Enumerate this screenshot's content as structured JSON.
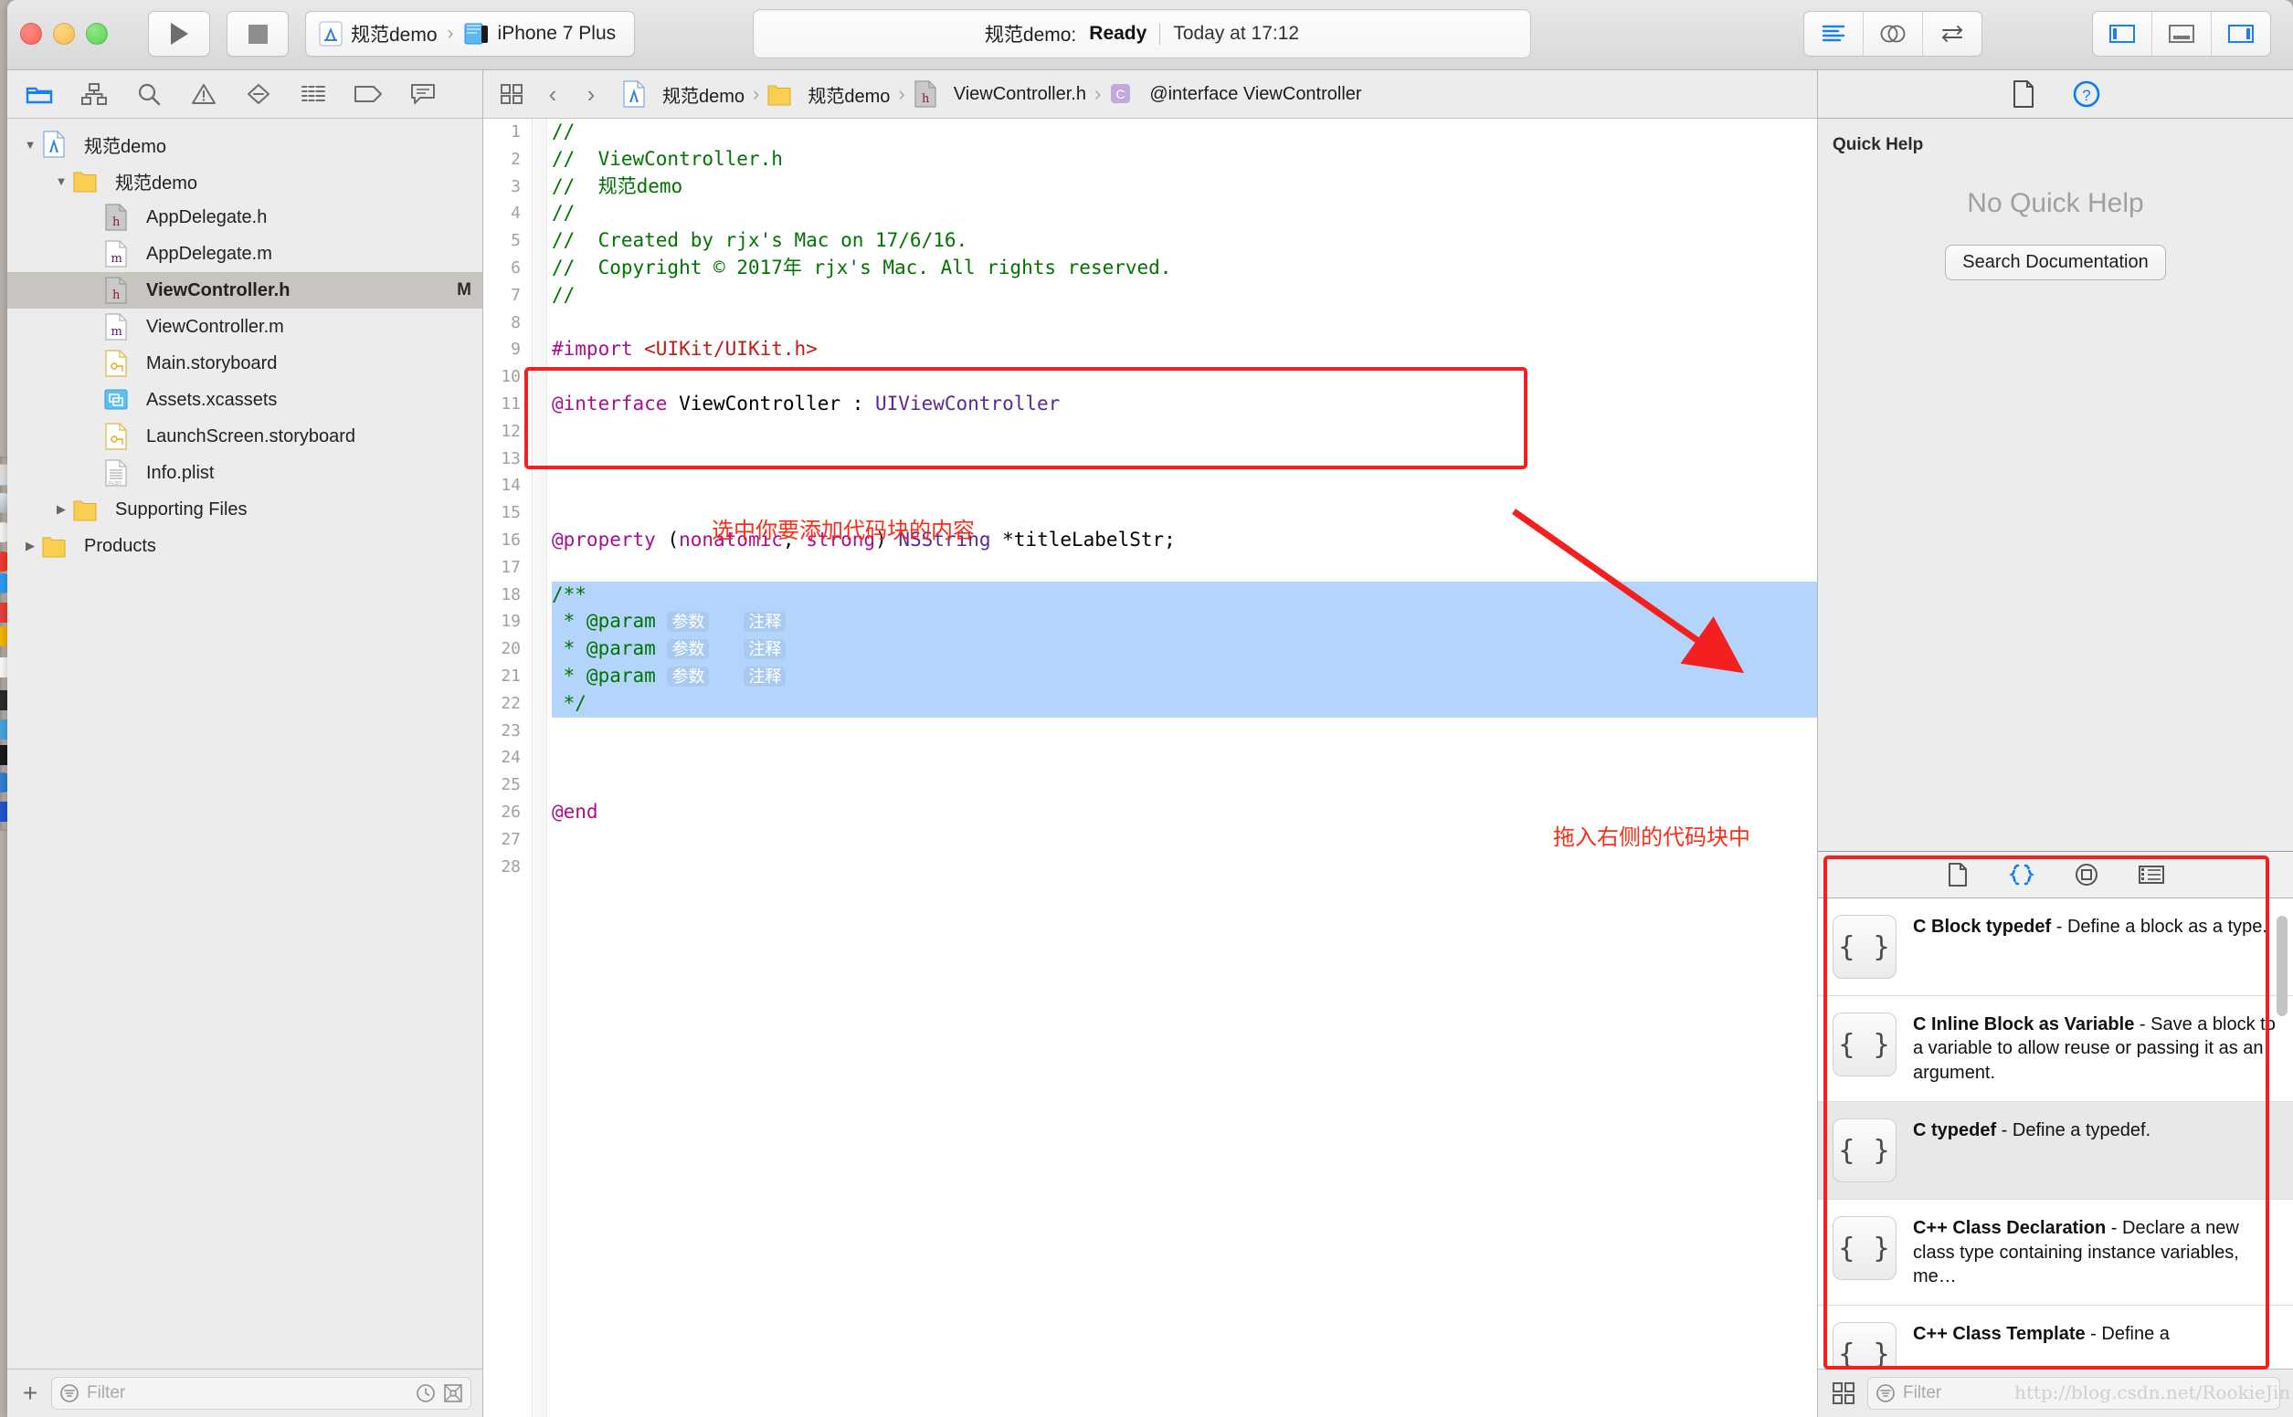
{
  "window": {
    "traffic_lights": [
      "close",
      "minimize",
      "zoom"
    ]
  },
  "toolbar": {
    "run_label": "Run",
    "stop_label": "Stop",
    "scheme_project": "规范demo",
    "scheme_separator": "›",
    "scheme_device": "iPhone 7 Plus",
    "status_project": "规范demo:",
    "status_state": "Ready",
    "status_time": "Today at 17:12",
    "editor_modes": [
      "standard-editor",
      "assistant-editor",
      "version-editor"
    ],
    "panel_toggles": [
      "navigator-toggle",
      "debug-area-toggle",
      "utilities-toggle"
    ]
  },
  "navigator": {
    "tabs": [
      "project-navigator",
      "source-control-navigator",
      "symbol-navigator",
      "find-navigator",
      "issue-navigator",
      "test-navigator",
      "debug-navigator",
      "breakpoint-navigator",
      "report-navigator"
    ],
    "active_tab": "project-navigator",
    "tree": [
      {
        "label": "规范demo",
        "icon": "xcode-project-icon",
        "indent": 0,
        "disclosure": "open",
        "selected": false,
        "flag": ""
      },
      {
        "label": "规范demo",
        "icon": "folder-icon",
        "indent": 1,
        "disclosure": "open",
        "selected": false,
        "flag": ""
      },
      {
        "label": "AppDelegate.h",
        "icon": "h-file-icon",
        "indent": 2,
        "disclosure": "none",
        "selected": false,
        "flag": ""
      },
      {
        "label": "AppDelegate.m",
        "icon": "m-file-icon",
        "indent": 2,
        "disclosure": "none",
        "selected": false,
        "flag": ""
      },
      {
        "label": "ViewController.h",
        "icon": "h-file-icon",
        "indent": 2,
        "disclosure": "none",
        "selected": true,
        "flag": "M"
      },
      {
        "label": "ViewController.m",
        "icon": "m-file-icon",
        "indent": 2,
        "disclosure": "none",
        "selected": false,
        "flag": ""
      },
      {
        "label": "Main.storyboard",
        "icon": "storyboard-icon",
        "indent": 2,
        "disclosure": "none",
        "selected": false,
        "flag": ""
      },
      {
        "label": "Assets.xcassets",
        "icon": "assets-icon",
        "indent": 2,
        "disclosure": "none",
        "selected": false,
        "flag": ""
      },
      {
        "label": "LaunchScreen.storyboard",
        "icon": "storyboard-icon",
        "indent": 2,
        "disclosure": "none",
        "selected": false,
        "flag": ""
      },
      {
        "label": "Info.plist",
        "icon": "plist-icon",
        "indent": 2,
        "disclosure": "none",
        "selected": false,
        "flag": ""
      },
      {
        "label": "Supporting Files",
        "icon": "folder-icon",
        "indent": 1,
        "disclosure": "closed",
        "selected": false,
        "flag": ""
      },
      {
        "label": "Products",
        "icon": "folder-icon",
        "indent": 0,
        "disclosure": "closed",
        "selected": false,
        "flag": ""
      }
    ],
    "add_label": "+",
    "filter_placeholder": "Filter"
  },
  "editor": {
    "breadcrumbs": [
      {
        "label": "规范demo",
        "icon": "xcode-project-icon"
      },
      {
        "label": "规范demo",
        "icon": "folder-icon"
      },
      {
        "label": "ViewController.h",
        "icon": "h-file-icon"
      },
      {
        "label": "@interface ViewController",
        "icon": "class-icon"
      }
    ],
    "back_arrow": "‹",
    "forward_arrow": "›",
    "lines": [
      {
        "n": 1,
        "segments": [
          {
            "t": "//",
            "c": "cmt"
          }
        ]
      },
      {
        "n": 2,
        "segments": [
          {
            "t": "//  ViewController.h",
            "c": "cmt"
          }
        ]
      },
      {
        "n": 3,
        "segments": [
          {
            "t": "//  规范demo",
            "c": "cmt"
          }
        ]
      },
      {
        "n": 4,
        "segments": [
          {
            "t": "//",
            "c": "cmt"
          }
        ]
      },
      {
        "n": 5,
        "segments": [
          {
            "t": "//  Created by rjx's Mac on 17/6/16.",
            "c": "cmt"
          }
        ]
      },
      {
        "n": 6,
        "segments": [
          {
            "t": "//  Copyright © 2017年 rjx's Mac. All rights reserved.",
            "c": "cmt"
          }
        ]
      },
      {
        "n": 7,
        "segments": [
          {
            "t": "//",
            "c": "cmt"
          }
        ]
      },
      {
        "n": 8,
        "segments": []
      },
      {
        "n": 9,
        "segments": [
          {
            "t": "#import ",
            "c": "kw"
          },
          {
            "t": "<UIKit/UIKit.h>",
            "c": "str"
          }
        ]
      },
      {
        "n": 10,
        "segments": []
      },
      {
        "n": 11,
        "segments": [
          {
            "t": "@interface",
            "c": "kw"
          },
          {
            "t": " ViewController : ",
            "c": ""
          },
          {
            "t": "UIViewController",
            "c": "typ"
          }
        ]
      },
      {
        "n": 12,
        "segments": []
      },
      {
        "n": 13,
        "segments": []
      },
      {
        "n": 14,
        "segments": []
      },
      {
        "n": 15,
        "segments": []
      },
      {
        "n": 16,
        "segments": [
          {
            "t": "@property",
            "c": "kw"
          },
          {
            "t": " (",
            "c": ""
          },
          {
            "t": "nonatomic",
            "c": "kw"
          },
          {
            "t": ", ",
            "c": ""
          },
          {
            "t": "strong",
            "c": "kw"
          },
          {
            "t": ") ",
            "c": ""
          },
          {
            "t": "NSString",
            "c": "typ"
          },
          {
            "t": " *titleLabelStr;",
            "c": ""
          }
        ]
      },
      {
        "n": 17,
        "segments": []
      },
      {
        "n": 18,
        "segments": [
          {
            "t": "/**",
            "c": "cmt"
          }
        ],
        "selected": true
      },
      {
        "n": 19,
        "segments": [
          {
            "t": " * @param ",
            "c": "cmt"
          },
          {
            "t": "参数",
            "c": "ph"
          },
          {
            "t": "   ",
            "c": "cmt"
          },
          {
            "t": "注释",
            "c": "ph"
          }
        ],
        "selected": true
      },
      {
        "n": 20,
        "segments": [
          {
            "t": " * @param ",
            "c": "cmt"
          },
          {
            "t": "参数",
            "c": "ph"
          },
          {
            "t": "   ",
            "c": "cmt"
          },
          {
            "t": "注释",
            "c": "ph"
          }
        ],
        "selected": true
      },
      {
        "n": 21,
        "segments": [
          {
            "t": " * @param ",
            "c": "cmt"
          },
          {
            "t": "参数",
            "c": "ph"
          },
          {
            "t": "   ",
            "c": "cmt"
          },
          {
            "t": "注释",
            "c": "ph"
          }
        ],
        "selected": true
      },
      {
        "n": 22,
        "segments": [
          {
            "t": " */",
            "c": "cmt"
          }
        ],
        "selected": true
      },
      {
        "n": 23,
        "segments": []
      },
      {
        "n": 24,
        "segments": []
      },
      {
        "n": 25,
        "segments": []
      },
      {
        "n": 26,
        "segments": [
          {
            "t": "@end",
            "c": "kw"
          }
        ]
      },
      {
        "n": 27,
        "segments": []
      },
      {
        "n": 28,
        "segments": []
      }
    ]
  },
  "annotations": [
    {
      "name": "select-code-annotation",
      "text": "选中你要添加代码块的内容"
    },
    {
      "name": "drag-to-library-annotation",
      "text": "拖入右侧的代码块中"
    }
  ],
  "utilities": {
    "tabs": [
      "file-inspector",
      "quick-help-inspector"
    ],
    "active_tab": "quick-help-inspector",
    "quick_help": {
      "title": "Quick Help",
      "empty_text": "No Quick Help",
      "search_button": "Search Documentation"
    },
    "library": {
      "tabs": [
        "file-template-library",
        "code-snippet-library",
        "object-library",
        "media-library"
      ],
      "active_tab": "code-snippet-library",
      "snippets": [
        {
          "icon": "{ }",
          "title": "C Block typedef",
          "dash": " - ",
          "desc": "Define a block as a type.",
          "selected": false
        },
        {
          "icon": "{ }",
          "title": "C Inline Block as Variable",
          "dash": " - ",
          "desc": "Save a block to a variable to allow reuse or passing it as an argument.",
          "selected": false
        },
        {
          "icon": "{ }",
          "title": "C typedef",
          "dash": " - ",
          "desc": "Define a typedef.",
          "selected": true
        },
        {
          "icon": "{ }",
          "title": "C++ Class Declaration",
          "dash": " - ",
          "desc": "Declare a new class type containing instance variables, me…",
          "selected": false
        },
        {
          "icon": "{ }",
          "title": "C++ Class Template",
          "dash": " - ",
          "desc": "Define a",
          "selected": false
        }
      ],
      "filter_placeholder": "Filter"
    }
  },
  "watermark": "http://blog.csdn.net/RookieJin",
  "colors": {
    "accent_blue": "#0a7cf0",
    "annotation_red": "#fd2c16",
    "highlight_box_red": "#f42020",
    "selection_blue": "#b4d5fb",
    "placeholder_blue": "#a9c9ef",
    "comment_green": "#007400",
    "keyword_magenta": "#aa0d91",
    "string_red": "#c41a16",
    "type_purple": "#5c2699"
  }
}
